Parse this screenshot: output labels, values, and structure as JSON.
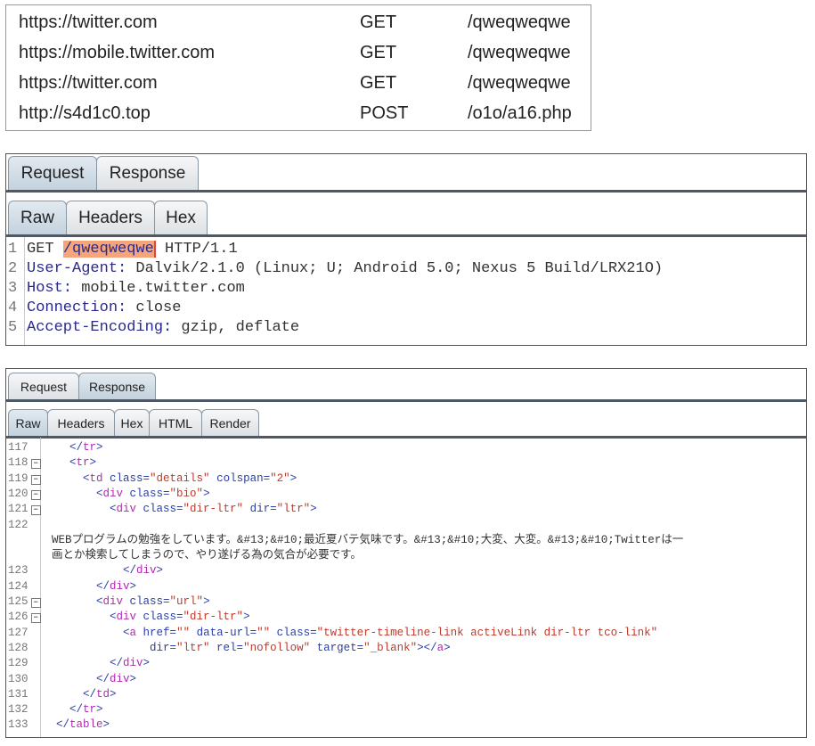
{
  "requests": [
    {
      "host": "https://twitter.com",
      "method": "GET",
      "path": "/qweqweqwe"
    },
    {
      "host": "https://mobile.twitter.com",
      "method": "GET",
      "path": "/qweqweqwe"
    },
    {
      "host": "https://twitter.com",
      "method": "GET",
      "path": "/qweqweqwe"
    },
    {
      "host": "http://s4d1c0.top",
      "method": "POST",
      "path": "/o1o/a16.php"
    }
  ],
  "request_panel": {
    "tabs": [
      "Request",
      "Response"
    ],
    "active_tab": "Request",
    "subtabs": [
      "Raw",
      "Headers",
      "Hex"
    ],
    "active_subtab": "Raw",
    "lines": [
      {
        "n": "1",
        "segs": [
          [
            "t",
            "GET "
          ],
          [
            "hl",
            "/qweqweqwe"
          ],
          [
            "t",
            " HTTP/1.1"
          ]
        ]
      },
      {
        "n": "2",
        "segs": [
          [
            "k",
            "User-Agent:"
          ],
          [
            "t",
            " Dalvik/2.1.0 (Linux; U; Android 5.0; Nexus 5 Build/LRX21O)"
          ]
        ]
      },
      {
        "n": "3",
        "segs": [
          [
            "k",
            "Host:"
          ],
          [
            "t",
            " mobile.twitter.com"
          ]
        ]
      },
      {
        "n": "4",
        "segs": [
          [
            "k",
            "Connection:"
          ],
          [
            "t",
            " close"
          ]
        ]
      },
      {
        "n": "5",
        "segs": [
          [
            "k",
            "Accept-Encoding:"
          ],
          [
            "t",
            " gzip, deflate"
          ]
        ]
      }
    ]
  },
  "response_panel": {
    "tabs": [
      "Request",
      "Response"
    ],
    "active_tab": "Response",
    "subtabs": [
      "Raw",
      "Headers",
      "Hex",
      "HTML",
      "Render"
    ],
    "active_subtab": "Raw",
    "lines": [
      {
        "n": "117",
        "fold": false,
        "segs": [
          [
            "b",
            "    </"
          ],
          [
            "tg",
            "tr"
          ],
          [
            "b",
            ">"
          ]
        ]
      },
      {
        "n": "118",
        "fold": true,
        "segs": [
          [
            "b",
            "    <"
          ],
          [
            "tg",
            "tr"
          ],
          [
            "b",
            ">"
          ]
        ]
      },
      {
        "n": "119",
        "fold": true,
        "segs": [
          [
            "b",
            "      <"
          ],
          [
            "tg",
            "td "
          ],
          [
            "at",
            "class="
          ],
          [
            "v",
            "\"details\" "
          ],
          [
            "at",
            "colspan="
          ],
          [
            "v",
            "\"2\""
          ],
          [
            "b",
            ">"
          ]
        ]
      },
      {
        "n": "120",
        "fold": true,
        "segs": [
          [
            "b",
            "        <"
          ],
          [
            "tg",
            "div "
          ],
          [
            "at",
            "class="
          ],
          [
            "v",
            "\"bio\""
          ],
          [
            "b",
            ">"
          ]
        ]
      },
      {
        "n": "121",
        "fold": true,
        "segs": [
          [
            "b",
            "          <"
          ],
          [
            "tg",
            "div "
          ],
          [
            "at",
            "class="
          ],
          [
            "v",
            "\"dir-ltr\" "
          ],
          [
            "at",
            "dir="
          ],
          [
            "v",
            "\"ltr\""
          ],
          [
            "b",
            ">"
          ]
        ]
      },
      {
        "n": "122",
        "fold": false,
        "segs": []
      },
      {
        "n": "",
        "fold": false,
        "segs": [
          [
            "txt",
            "WEBプログラムの勉強をしています。&#13;&#10;最近夏バテ気味です。&#13;&#10;大変、大変。&#13;&#10;Twitterは一"
          ]
        ]
      },
      {
        "n": "",
        "fold": false,
        "segs": [
          [
            "txt",
            "画とか検索してしまうので、やり遂げる為の気合が必要です。"
          ]
        ]
      },
      {
        "n": "123",
        "fold": false,
        "segs": [
          [
            "b",
            "            </"
          ],
          [
            "tg",
            "div"
          ],
          [
            "b",
            ">"
          ]
        ]
      },
      {
        "n": "124",
        "fold": false,
        "segs": [
          [
            "b",
            "        </"
          ],
          [
            "tg",
            "div"
          ],
          [
            "b",
            ">"
          ]
        ]
      },
      {
        "n": "125",
        "fold": true,
        "segs": [
          [
            "b",
            "        <"
          ],
          [
            "tg",
            "div "
          ],
          [
            "at",
            "class="
          ],
          [
            "v",
            "\"url\""
          ],
          [
            "b",
            ">"
          ]
        ]
      },
      {
        "n": "126",
        "fold": true,
        "segs": [
          [
            "b",
            "          <"
          ],
          [
            "tg",
            "div "
          ],
          [
            "at",
            "class="
          ],
          [
            "v",
            "\"dir-ltr\""
          ],
          [
            "b",
            ">"
          ]
        ]
      },
      {
        "n": "127",
        "fold": false,
        "segs": [
          [
            "b",
            "            <"
          ],
          [
            "tg",
            "a "
          ],
          [
            "at",
            "href="
          ],
          [
            "v",
            "\"\" "
          ],
          [
            "at",
            "data-url="
          ],
          [
            "v",
            "\"\" "
          ],
          [
            "at",
            "class="
          ],
          [
            "v",
            "\"twitter-timeline-link activeLink dir-ltr tco-link\""
          ]
        ]
      },
      {
        "n": "128",
        "fold": false,
        "segs": [
          [
            "at",
            "                dir="
          ],
          [
            "v",
            "\"ltr\" "
          ],
          [
            "at",
            "rel="
          ],
          [
            "v",
            "\"nofollow\" "
          ],
          [
            "at",
            "target="
          ],
          [
            "v",
            "\"_blank\""
          ],
          [
            "b",
            ">"
          ],
          [
            "b",
            "</"
          ],
          [
            "tg",
            "a"
          ],
          [
            "b",
            ">"
          ]
        ]
      },
      {
        "n": "129",
        "fold": false,
        "segs": [
          [
            "b",
            "          </"
          ],
          [
            "tg",
            "div"
          ],
          [
            "b",
            ">"
          ]
        ]
      },
      {
        "n": "130",
        "fold": false,
        "segs": [
          [
            "b",
            "        </"
          ],
          [
            "tg",
            "div"
          ],
          [
            "b",
            ">"
          ]
        ]
      },
      {
        "n": "131",
        "fold": false,
        "segs": [
          [
            "b",
            "      </"
          ],
          [
            "tg",
            "td"
          ],
          [
            "b",
            ">"
          ]
        ]
      },
      {
        "n": "132",
        "fold": false,
        "segs": [
          [
            "b",
            "    </"
          ],
          [
            "tg",
            "tr"
          ],
          [
            "b",
            ">"
          ]
        ]
      },
      {
        "n": "133",
        "fold": false,
        "segs": [
          [
            "b",
            "  </"
          ],
          [
            "tg",
            "table"
          ],
          [
            "b",
            ">"
          ]
        ]
      }
    ]
  }
}
